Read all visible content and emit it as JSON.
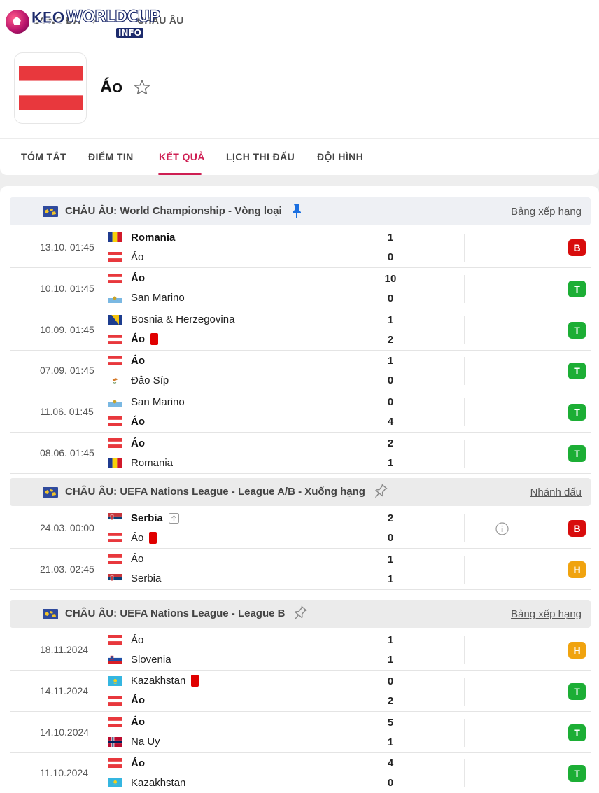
{
  "header": {
    "logo": {
      "text1": "KEO",
      "text2": "WORLDCUP",
      "badge": "INFO"
    },
    "breadcrumb": [
      "BÓNG ĐÁ",
      "CHÂU ÂU"
    ],
    "team_name": "Áo",
    "tabs": [
      {
        "label": "TÓM TẮT",
        "active": false
      },
      {
        "label": "ĐIỂM TIN",
        "active": false
      },
      {
        "label": "KẾT QUẢ",
        "active": true
      },
      {
        "label": "LỊCH THI ĐẤU",
        "active": false
      },
      {
        "label": "ĐỘI HÌNH",
        "active": false
      }
    ]
  },
  "colors": {
    "accent": "#ce1e52",
    "win": "#1cae35",
    "loss": "#d80c0c",
    "draw": "#f0a30f",
    "red_card": "#e00000"
  },
  "groups": [
    {
      "league": "CHÂU ÂU: World Championship - Vòng loại",
      "link": "Bảng xếp hạng",
      "pinned": true,
      "matches": [
        {
          "date": "13.10. 01:45",
          "home": "Romania",
          "away": "Áo",
          "home_score": "1",
          "away_score": "0",
          "result": "B",
          "winner": "home"
        },
        {
          "date": "10.10. 01:45",
          "home": "Áo",
          "away": "San Marino",
          "home_score": "10",
          "away_score": "0",
          "result": "T",
          "winner": "home"
        },
        {
          "date": "10.09. 01:45",
          "home": "Bosnia & Herzegovina",
          "away": "Áo",
          "home_score": "1",
          "away_score": "2",
          "result": "T",
          "winner": "away",
          "away_red_card": true
        },
        {
          "date": "07.09. 01:45",
          "home": "Áo",
          "away": "Đảo Síp",
          "home_score": "1",
          "away_score": "0",
          "result": "T",
          "winner": "home"
        },
        {
          "date": "11.06. 01:45",
          "home": "San Marino",
          "away": "Áo",
          "home_score": "0",
          "away_score": "4",
          "result": "T",
          "winner": "away"
        },
        {
          "date": "08.06. 01:45",
          "home": "Áo",
          "away": "Romania",
          "home_score": "2",
          "away_score": "1",
          "result": "T",
          "winner": "home"
        }
      ]
    },
    {
      "league": "CHÂU ÂU: UEFA Nations League - League A/B - Xuống hạng",
      "link": "Nhánh đấu",
      "pinned": false,
      "matches": [
        {
          "date": "24.03. 00:00",
          "home": "Serbia",
          "away": "Áo",
          "home_score": "2",
          "away_score": "0",
          "result": "B",
          "winner": "home",
          "home_up_icon": true,
          "away_red_card": true,
          "info_icon": true
        },
        {
          "date": "21.03. 02:45",
          "home": "Áo",
          "away": "Serbia",
          "home_score": "1",
          "away_score": "1",
          "result": "H",
          "winner": "none"
        }
      ]
    },
    {
      "league": "CHÂU ÂU: UEFA Nations League - League B",
      "link": "Bảng xếp hạng",
      "pinned": false,
      "matches": [
        {
          "date": "18.11.2024",
          "home": "Áo",
          "away": "Slovenia",
          "home_score": "1",
          "away_score": "1",
          "result": "H",
          "winner": "none"
        },
        {
          "date": "14.11.2024",
          "home": "Kazakhstan",
          "away": "Áo",
          "home_score": "0",
          "away_score": "2",
          "result": "T",
          "winner": "away",
          "home_red_card": true
        },
        {
          "date": "14.10.2024",
          "home": "Áo",
          "away": "Na Uy",
          "home_score": "5",
          "away_score": "1",
          "result": "T",
          "winner": "home"
        },
        {
          "date": "11.10.2024",
          "home": "Áo",
          "away": "Kazakhstan",
          "home_score": "4",
          "away_score": "0",
          "result": "T",
          "winner": "home"
        }
      ]
    }
  ]
}
